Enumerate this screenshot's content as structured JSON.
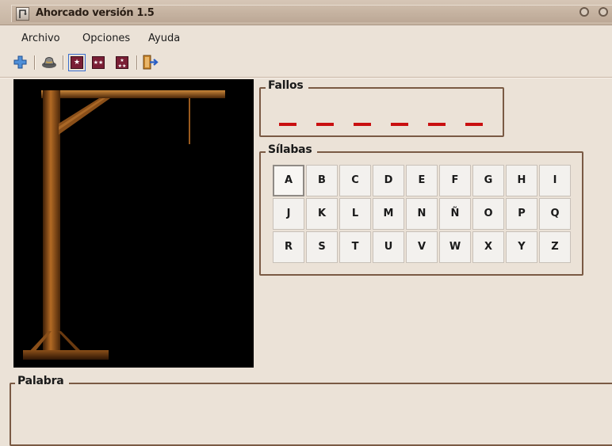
{
  "window": {
    "title": "Ahorcado versión 1.5",
    "icon": "app-icon"
  },
  "menu": [
    "Archivo",
    "Opciones",
    "Ayuda"
  ],
  "toolbar": {
    "icons": [
      "new-game-icon",
      "hat-icon",
      "level-1-star-icon",
      "level-2-stars-icon",
      "level-3-stars-icon",
      "exit-icon"
    ],
    "selected_level": 1
  },
  "fallos": {
    "title": "Fallos",
    "slots": 6,
    "color": "#c91010"
  },
  "silabas": {
    "title": "Sílabas",
    "rows": [
      [
        "A",
        "B",
        "C",
        "D",
        "E",
        "F",
        "G",
        "H",
        "I"
      ],
      [
        "J",
        "K",
        "L",
        "M",
        "N",
        "Ñ",
        "O",
        "P",
        "Q"
      ],
      [
        "R",
        "S",
        "T",
        "U",
        "V",
        "W",
        "X",
        "Y",
        "Z"
      ]
    ],
    "focused": "A"
  },
  "palabra": {
    "title": "Palabra"
  }
}
